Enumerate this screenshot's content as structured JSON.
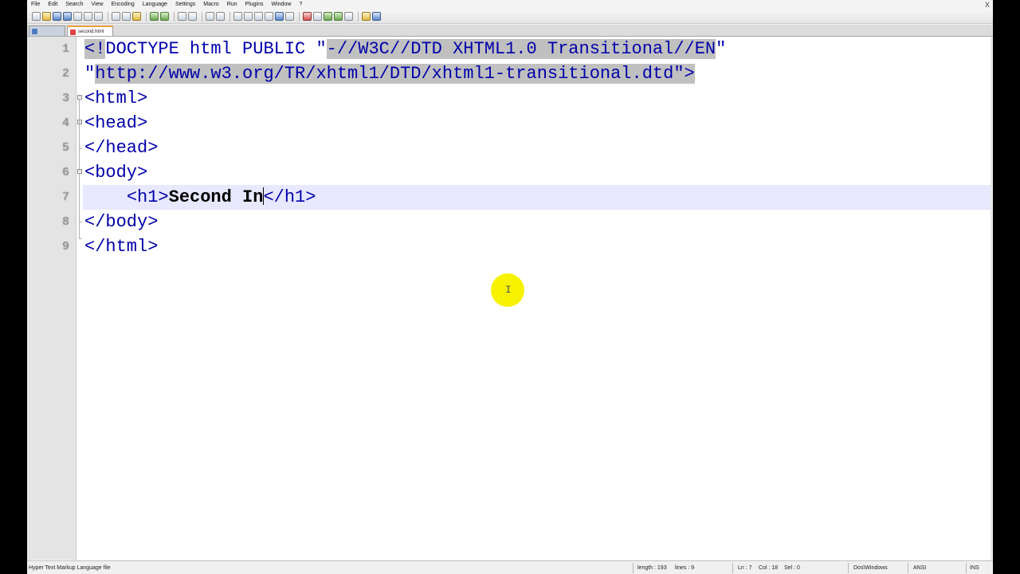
{
  "menu": [
    "File",
    "Edit",
    "Search",
    "View",
    "Encoding",
    "Language",
    "Settings",
    "Macro",
    "Run",
    "Plugins",
    "Window",
    "?"
  ],
  "window_close": "X",
  "tabs": [
    {
      "label": ""
    },
    {
      "label": "second.html"
    }
  ],
  "line_numbers": [
    "1",
    "2",
    "3",
    "4",
    "5",
    "6",
    "7",
    "8",
    "9"
  ],
  "code": {
    "line1": {
      "pre": "<!",
      "sel_a": "DOCTYPE html PUBLIC \"",
      "sel_b": "-//W3C//DTD XHTML1.0 Transitional//EN",
      "post": "\""
    },
    "line2": {
      "pre": "\"",
      "sel_a": "http://www.w3.org/TR/xhtml1/DTD/xhtml1-transitional.dtd",
      "post": "\">"
    },
    "line3": "<html>",
    "line4": "<head>",
    "line5": "</head>",
    "line6": "<body>",
    "line7": {
      "indent": "    ",
      "open": "<h1>",
      "text": "Second In",
      "close": "</h1>"
    },
    "line8": "</body>",
    "line9": "</html>"
  },
  "cursor_glyph": "I",
  "status": {
    "file_type": "Hyper Text Markup Language file",
    "length": "length : 193",
    "lines": "lines : 9",
    "ln": "Ln : 7",
    "col": "Col : 18",
    "sel": "Sel : 0",
    "eol": "Dos\\Windows",
    "encoding": "ANSI",
    "mode": "INS"
  }
}
